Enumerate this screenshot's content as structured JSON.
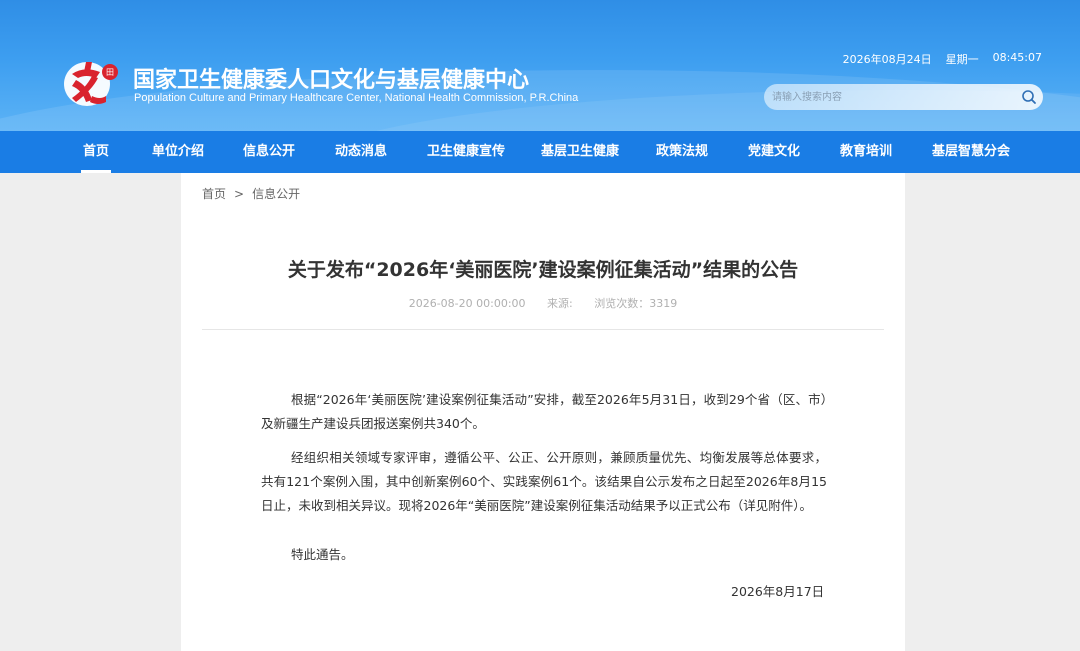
{
  "header": {
    "title": "国家卫生健康委人口文化与基层健康中心",
    "subtitle": "Population Culture and Primary Healthcare Center, National Health Commission, P.R.China",
    "date": "2026年08月24日",
    "weekday": "星期一",
    "time": "08:45:07",
    "search_placeholder": "请输入搜索内容"
  },
  "nav": {
    "items": [
      {
        "label": "首页"
      },
      {
        "label": "单位介绍"
      },
      {
        "label": "信息公开"
      },
      {
        "label": "动态消息"
      },
      {
        "label": "卫生健康宣传"
      },
      {
        "label": "基层卫生健康"
      },
      {
        "label": "政策法规"
      },
      {
        "label": "党建文化"
      },
      {
        "label": "教育培训"
      },
      {
        "label": "基层智慧分会"
      }
    ]
  },
  "breadcrumb": {
    "home": "首页",
    "separator": ">",
    "current": "信息公开"
  },
  "article": {
    "title": "关于发布“2026年‘美丽医院’建设案例征集活动”结果的公告",
    "published": "2026-08-20 00:00:00",
    "source": "来源:",
    "views": "浏览次数：3319",
    "paragraphs": [
      "根据“2026年‘美丽医院’建设案例征集活动”安排，截至2026年5月31日，收到29个省（区、市）及新疆生产建设兵团报送案例共340个。",
      "经组织相关领域专家评审，遵循公平、公正、公开原则，兼顾质量优先、均衡发展等总体要求，共有121个案例入围，其中创新案例60个、实践案例61个。该结果自公示发布之日起至2026年8月15日止，未收到相关异议。现将2026年“美丽医院”建设案例征集活动结果予以正式公布（详见附件）。",
      "特此通告。"
    ],
    "sign_date": "2026年8月17日"
  },
  "colors": {
    "header_top": "#2f8ee6",
    "nav_bg": "#1a7de5",
    "logo_red": "#d9232e",
    "page_bg": "#eeeeee"
  }
}
